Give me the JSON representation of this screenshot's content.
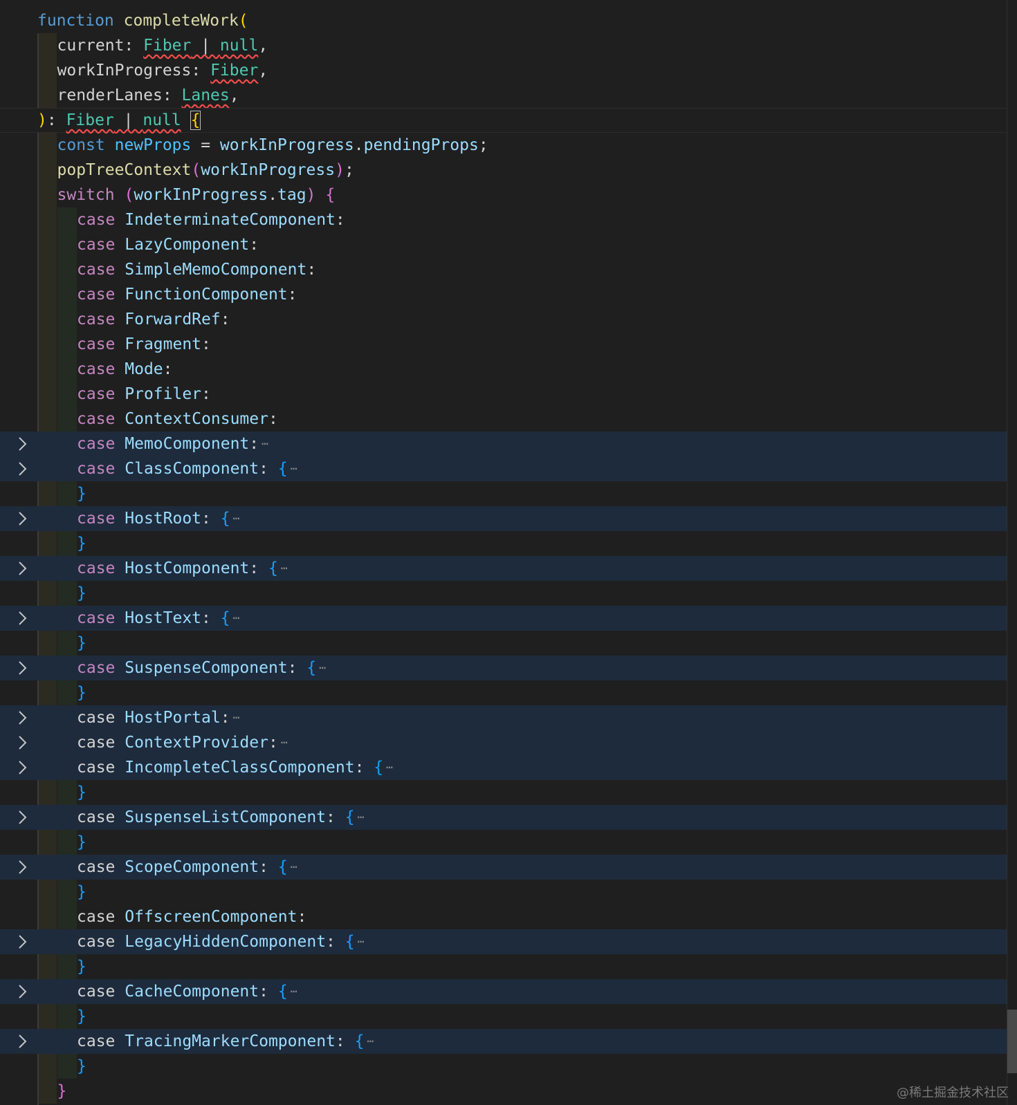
{
  "editor": {
    "lines": [
      {
        "indent": 0,
        "tokens": [
          [
            "kw",
            "function "
          ],
          [
            "fn",
            "completeWork"
          ],
          [
            "b1",
            "("
          ]
        ]
      },
      {
        "indent": 1,
        "tokens": [
          [
            "txt",
            "current: "
          ],
          [
            "type sq",
            "Fiber"
          ],
          [
            "txt sq",
            " | "
          ],
          [
            "type sq",
            "null"
          ],
          [
            "txt",
            ","
          ]
        ]
      },
      {
        "indent": 1,
        "tokens": [
          [
            "txt",
            "workInProgress: "
          ],
          [
            "type sq",
            "Fiber"
          ],
          [
            "txt",
            ","
          ]
        ]
      },
      {
        "indent": 1,
        "tokens": [
          [
            "txt",
            "renderLanes: "
          ],
          [
            "type sq",
            "Lanes"
          ],
          [
            "txt",
            ","
          ]
        ]
      },
      {
        "indent": 0,
        "current": true,
        "tokens": [
          [
            "b1",
            ")"
          ],
          [
            "txt",
            ": "
          ],
          [
            "type sq",
            "Fiber"
          ],
          [
            "txt sq",
            " | "
          ],
          [
            "type sq",
            "null"
          ],
          [
            "txt",
            " "
          ],
          [
            "b1 cur",
            "{"
          ]
        ]
      },
      {
        "indent": 1,
        "tokens": [
          [
            "kw",
            "const "
          ],
          [
            "const",
            "newProps"
          ],
          [
            "txt",
            " = "
          ],
          [
            "var",
            "workInProgress"
          ],
          [
            "txt",
            "."
          ],
          [
            "var",
            "pendingProps"
          ],
          [
            "txt",
            ";"
          ]
        ]
      },
      {
        "indent": 1,
        "tokens": [
          [
            "fn",
            "popTreeContext"
          ],
          [
            "b2",
            "("
          ],
          [
            "var",
            "workInProgress"
          ],
          [
            "b2",
            ")"
          ],
          [
            "txt",
            ";"
          ]
        ]
      },
      {
        "indent": 1,
        "tokens": [
          [
            "ctrl",
            "switch"
          ],
          [
            "txt",
            " "
          ],
          [
            "b2",
            "("
          ],
          [
            "var",
            "workInProgress"
          ],
          [
            "txt",
            "."
          ],
          [
            "var",
            "tag"
          ],
          [
            "b2",
            ")"
          ],
          [
            "txt",
            " "
          ],
          [
            "b2",
            "{"
          ]
        ]
      },
      {
        "indent": 2,
        "tokens": [
          [
            "ctrl",
            "case "
          ],
          [
            "var",
            "IndeterminateComponent"
          ],
          [
            "txt",
            ":"
          ]
        ]
      },
      {
        "indent": 2,
        "tokens": [
          [
            "ctrl",
            "case "
          ],
          [
            "var",
            "LazyComponent"
          ],
          [
            "txt",
            ":"
          ]
        ]
      },
      {
        "indent": 2,
        "tokens": [
          [
            "ctrl",
            "case "
          ],
          [
            "var",
            "SimpleMemoComponent"
          ],
          [
            "txt",
            ":"
          ]
        ]
      },
      {
        "indent": 2,
        "tokens": [
          [
            "ctrl",
            "case "
          ],
          [
            "var",
            "FunctionComponent"
          ],
          [
            "txt",
            ":"
          ]
        ]
      },
      {
        "indent": 2,
        "tokens": [
          [
            "ctrl",
            "case "
          ],
          [
            "var",
            "ForwardRef"
          ],
          [
            "txt",
            ":"
          ]
        ]
      },
      {
        "indent": 2,
        "tokens": [
          [
            "ctrl",
            "case "
          ],
          [
            "var",
            "Fragment"
          ],
          [
            "txt",
            ":"
          ]
        ]
      },
      {
        "indent": 2,
        "tokens": [
          [
            "ctrl",
            "case "
          ],
          [
            "var",
            "Mode"
          ],
          [
            "txt",
            ":"
          ]
        ]
      },
      {
        "indent": 2,
        "tokens": [
          [
            "ctrl",
            "case "
          ],
          [
            "var",
            "Profiler"
          ],
          [
            "txt",
            ":"
          ]
        ]
      },
      {
        "indent": 2,
        "tokens": [
          [
            "ctrl",
            "case "
          ],
          [
            "var",
            "ContextConsumer"
          ],
          [
            "txt",
            ":"
          ]
        ]
      },
      {
        "indent": 2,
        "folded": true,
        "ellipsis": true,
        "tokens": [
          [
            "ctrl",
            "case "
          ],
          [
            "var",
            "MemoComponent"
          ],
          [
            "txt",
            ":"
          ]
        ]
      },
      {
        "indent": 2,
        "folded": true,
        "ellipsis": true,
        "tokens": [
          [
            "ctrl",
            "case "
          ],
          [
            "var",
            "ClassComponent"
          ],
          [
            "txt",
            ": "
          ],
          [
            "b3",
            "{"
          ]
        ]
      },
      {
        "indent": 2,
        "tokens": [
          [
            "b3",
            "}"
          ]
        ]
      },
      {
        "indent": 2,
        "folded": true,
        "ellipsis": true,
        "tokens": [
          [
            "ctrl",
            "case "
          ],
          [
            "var",
            "HostRoot"
          ],
          [
            "txt",
            ": "
          ],
          [
            "b3",
            "{"
          ]
        ]
      },
      {
        "indent": 2,
        "tokens": [
          [
            "b3",
            "}"
          ]
        ]
      },
      {
        "indent": 2,
        "folded": true,
        "ellipsis": true,
        "tokens": [
          [
            "ctrl",
            "case "
          ],
          [
            "var",
            "HostComponent"
          ],
          [
            "txt",
            ": "
          ],
          [
            "b3",
            "{"
          ]
        ]
      },
      {
        "indent": 2,
        "tokens": [
          [
            "b3",
            "}"
          ]
        ]
      },
      {
        "indent": 2,
        "folded": true,
        "ellipsis": true,
        "tokens": [
          [
            "ctrl",
            "case "
          ],
          [
            "var",
            "HostText"
          ],
          [
            "txt",
            ": "
          ],
          [
            "b3",
            "{"
          ]
        ]
      },
      {
        "indent": 2,
        "tokens": [
          [
            "b3",
            "}"
          ]
        ]
      },
      {
        "indent": 2,
        "folded": true,
        "ellipsis": true,
        "tokens": [
          [
            "ctrl",
            "case "
          ],
          [
            "var",
            "SuspenseComponent"
          ],
          [
            "txt",
            ": "
          ],
          [
            "b3",
            "{"
          ]
        ]
      },
      {
        "indent": 2,
        "tokens": [
          [
            "b3",
            "}"
          ]
        ]
      },
      {
        "indent": 2,
        "folded": true,
        "ellipsis": true,
        "tokens": [
          [
            "txt",
            "case "
          ],
          [
            "var",
            "HostPortal"
          ],
          [
            "txt",
            ":"
          ]
        ]
      },
      {
        "indent": 2,
        "folded": true,
        "ellipsis": true,
        "tokens": [
          [
            "txt",
            "case "
          ],
          [
            "var",
            "ContextProvider"
          ],
          [
            "txt",
            ":"
          ]
        ]
      },
      {
        "indent": 2,
        "folded": true,
        "ellipsis": true,
        "tokens": [
          [
            "txt",
            "case "
          ],
          [
            "var",
            "IncompleteClassComponent"
          ],
          [
            "txt",
            ": "
          ],
          [
            "b3",
            "{"
          ]
        ]
      },
      {
        "indent": 2,
        "tokens": [
          [
            "b3",
            "}"
          ]
        ]
      },
      {
        "indent": 2,
        "folded": true,
        "ellipsis": true,
        "tokens": [
          [
            "txt",
            "case "
          ],
          [
            "var",
            "SuspenseListComponent"
          ],
          [
            "txt",
            ": "
          ],
          [
            "b3",
            "{"
          ]
        ]
      },
      {
        "indent": 2,
        "tokens": [
          [
            "b3",
            "}"
          ]
        ]
      },
      {
        "indent": 2,
        "folded": true,
        "ellipsis": true,
        "tokens": [
          [
            "txt",
            "case "
          ],
          [
            "var",
            "ScopeComponent"
          ],
          [
            "txt",
            ": "
          ],
          [
            "b3",
            "{"
          ]
        ]
      },
      {
        "indent": 2,
        "tokens": [
          [
            "b3",
            "}"
          ]
        ]
      },
      {
        "indent": 2,
        "tokens": [
          [
            "txt",
            "case "
          ],
          [
            "var",
            "OffscreenComponent"
          ],
          [
            "txt",
            ":"
          ]
        ]
      },
      {
        "indent": 2,
        "folded": true,
        "ellipsis": true,
        "tokens": [
          [
            "txt",
            "case "
          ],
          [
            "var",
            "LegacyHiddenComponent"
          ],
          [
            "txt",
            ": "
          ],
          [
            "b3",
            "{"
          ]
        ]
      },
      {
        "indent": 2,
        "tokens": [
          [
            "b3",
            "}"
          ]
        ]
      },
      {
        "indent": 2,
        "folded": true,
        "ellipsis": true,
        "tokens": [
          [
            "txt",
            "case "
          ],
          [
            "var",
            "CacheComponent"
          ],
          [
            "txt",
            ": "
          ],
          [
            "b3",
            "{"
          ]
        ]
      },
      {
        "indent": 2,
        "tokens": [
          [
            "b3",
            "}"
          ]
        ]
      },
      {
        "indent": 2,
        "folded": true,
        "ellipsis": true,
        "tokens": [
          [
            "txt",
            "case "
          ],
          [
            "var",
            "TracingMarkerComponent"
          ],
          [
            "txt",
            ": "
          ],
          [
            "b3",
            "{"
          ]
        ]
      },
      {
        "indent": 2,
        "tokens": [
          [
            "b3",
            "}"
          ]
        ]
      },
      {
        "indent": 1,
        "tokens": [
          [
            "b2",
            "}"
          ]
        ]
      }
    ],
    "ellipsis_glyph": "⋯",
    "fold_icon": "chevron-right-icon"
  },
  "watermark": "@稀土掘金技术社区"
}
